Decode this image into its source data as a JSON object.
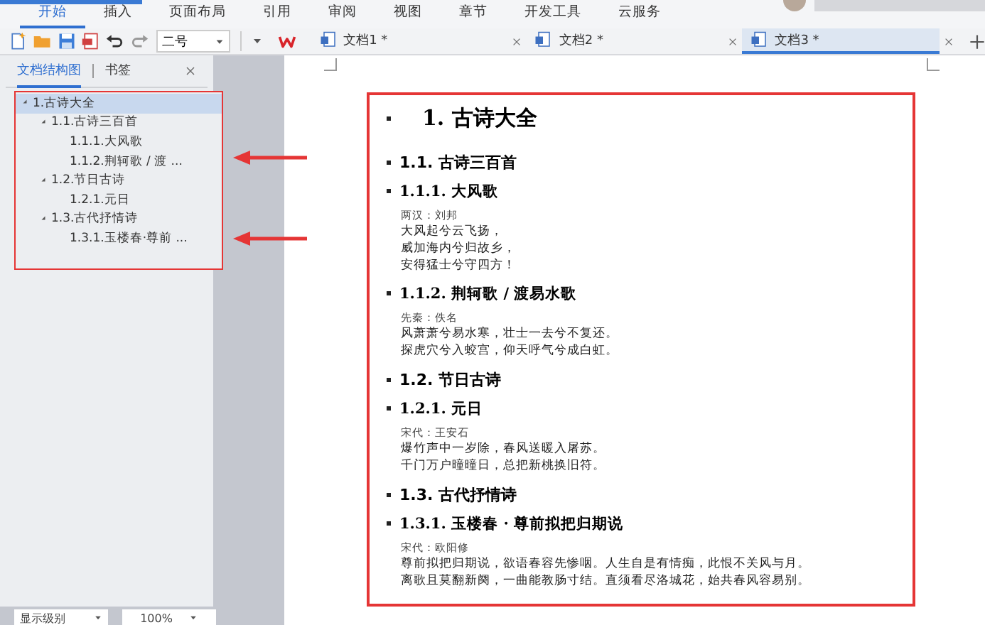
{
  "menu": [
    {
      "label": "开始",
      "selected": true
    },
    {
      "label": "插入",
      "selected": false
    },
    {
      "label": "页面布局",
      "selected": false
    },
    {
      "label": "引用",
      "selected": false
    },
    {
      "label": "审阅",
      "selected": false
    },
    {
      "label": "视图",
      "selected": false
    },
    {
      "label": "章节",
      "selected": false
    },
    {
      "label": "开发工具",
      "selected": false
    },
    {
      "label": "云服务",
      "selected": false
    }
  ],
  "toolbar": {
    "font_size": "二号"
  },
  "doc_tabs": [
    {
      "title": "文档1 *",
      "selected": false
    },
    {
      "title": "文档2 *",
      "selected": false
    },
    {
      "title": "文档3 *",
      "selected": true
    }
  ],
  "nav_panel": {
    "tabs": [
      {
        "label": "文档结构图",
        "selected": true
      },
      {
        "label": "书签",
        "selected": false
      }
    ],
    "tree": [
      {
        "label": "1.古诗大全",
        "selected": true,
        "expanded": true,
        "children": [
          {
            "label": "1.1.古诗三百首",
            "selected": false,
            "expanded": true,
            "children": [
              {
                "label": "1.1.1.大风歌",
                "selected": false
              },
              {
                "label": "1.1.2.荆轲歌 / 渡 ...",
                "selected": false
              }
            ]
          },
          {
            "label": "1.2.节日古诗",
            "selected": false,
            "expanded": true,
            "children": [
              {
                "label": "1.2.1.元日",
                "selected": false
              }
            ]
          },
          {
            "label": "1.3.古代抒情诗",
            "selected": false,
            "expanded": true,
            "children": [
              {
                "label": "1.3.1.玉楼春·尊前 ...",
                "selected": false
              }
            ]
          }
        ]
      }
    ],
    "level_select": "显示级别",
    "zoom_select": "100%"
  },
  "document": [
    {
      "kind": "h1",
      "text": "1. 古诗大全"
    },
    {
      "kind": "h2",
      "text": "1.1.  古诗三百首"
    },
    {
      "kind": "h3",
      "text": "1.1.1. 大风歌"
    },
    {
      "kind": "author",
      "text": "两汉：刘邦"
    },
    {
      "kind": "line",
      "text": "大风起兮云飞扬，"
    },
    {
      "kind": "line",
      "text": "威加海内兮归故乡，"
    },
    {
      "kind": "line",
      "text": "安得猛士兮守四方！"
    },
    {
      "kind": "h3",
      "text": "1.1.2. 荆轲歌 / 渡易水歌"
    },
    {
      "kind": "author",
      "text": "先秦：佚名"
    },
    {
      "kind": "line",
      "text": "风萧萧兮易水寒，壮士一去兮不复还。"
    },
    {
      "kind": "line",
      "text": "探虎穴兮入蛟宫，仰天呼气兮成白虹。"
    },
    {
      "kind": "h2",
      "text": "1.2.  节日古诗"
    },
    {
      "kind": "h3",
      "text": "1.2.1. 元日"
    },
    {
      "kind": "author",
      "text": "宋代：王安石"
    },
    {
      "kind": "line",
      "text": "爆竹声中一岁除，春风送暖入屠苏。"
    },
    {
      "kind": "line",
      "text": "千门万户曈曈日，总把新桃换旧符。"
    },
    {
      "kind": "h2",
      "text": "1.3.  古代抒情诗"
    },
    {
      "kind": "h3",
      "text": "1.3.1. 玉楼春 · 尊前拟把归期说"
    },
    {
      "kind": "author",
      "text": "宋代：欧阳修"
    },
    {
      "kind": "line",
      "text": "尊前拟把归期说，欲语春容先惨咽。人生自是有情痴，此恨不关风与月。"
    },
    {
      "kind": "line",
      "text": "离歌且莫翻新阕，一曲能教肠寸结。直须看尽洛城花，始共春风容易别。"
    }
  ]
}
